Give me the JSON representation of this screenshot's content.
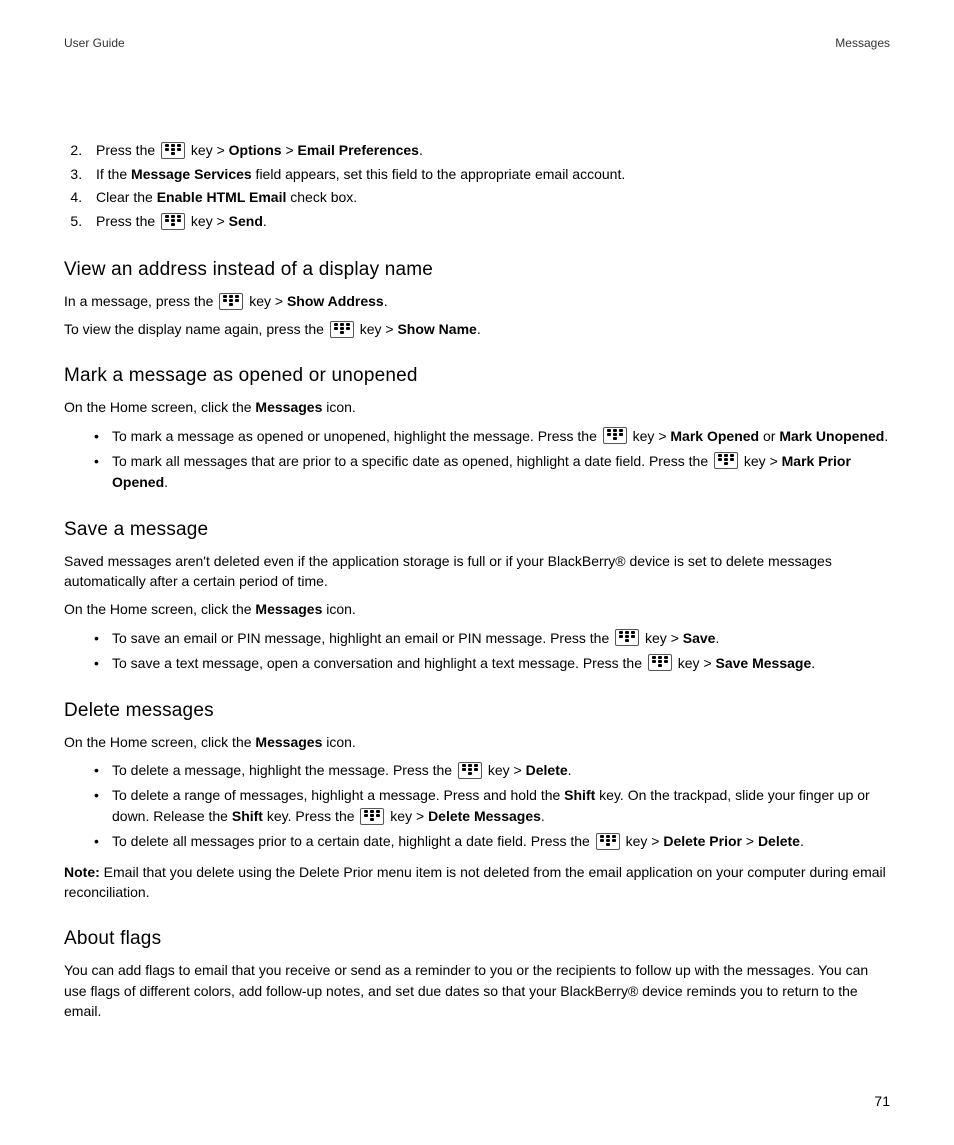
{
  "header": {
    "left": "User Guide",
    "right": "Messages"
  },
  "page_number": "71",
  "steps": {
    "s2": {
      "num": "2.",
      "pre": "Press the ",
      "key_after": " key > ",
      "b1": "Options",
      "mid": " > ",
      "b2": "Email Preferences",
      "end": "."
    },
    "s3": {
      "num": "3.",
      "pre": "If the ",
      "b1": "Message Services",
      "post": " field appears, set this field to the appropriate email account."
    },
    "s4": {
      "num": "4.",
      "pre": "Clear the ",
      "b1": "Enable HTML Email",
      "post": " check box."
    },
    "s5": {
      "num": "5.",
      "pre": "Press the ",
      "key_after": " key > ",
      "b1": "Send",
      "end": "."
    }
  },
  "sec_view": {
    "title": "View an address instead of a display name",
    "p1": {
      "pre": "In a message, press the ",
      "key_after": " key > ",
      "b1": "Show Address",
      "end": "."
    },
    "p2": {
      "pre": "To view the display name again, press the ",
      "key_after": " key > ",
      "b1": "Show Name",
      "end": "."
    }
  },
  "sec_mark": {
    "title": "Mark a message as opened or unopened",
    "intro_pre": "On the Home screen, click the ",
    "intro_b": "Messages",
    "intro_post": " icon.",
    "b1": {
      "pre": "To mark a message as opened or unopened, highlight the message. Press the ",
      "key_after": " key > ",
      "bA": "Mark Opened",
      "mid": " or ",
      "bB": "Mark Unopened",
      "end": "."
    },
    "b2": {
      "pre": "To mark all messages that are prior to a specific date as opened, highlight a date field. Press the ",
      "key_after": " key > ",
      "bA": "Mark Prior Opened",
      "end": "."
    }
  },
  "sec_save": {
    "title": "Save a message",
    "p1": "Saved messages aren't deleted even if the application storage is full or if your BlackBerry® device is set to delete messages automatically after a certain period of time.",
    "intro_pre": "On the Home screen, click the ",
    "intro_b": "Messages",
    "intro_post": " icon.",
    "b1": {
      "pre": "To save an email or PIN message, highlight an email or PIN message. Press the ",
      "key_after": " key > ",
      "bA": "Save",
      "end": "."
    },
    "b2": {
      "pre": "To save a text message, open a conversation and highlight a text message. Press the ",
      "key_after": " key > ",
      "bA": "Save Message",
      "end": "."
    }
  },
  "sec_del": {
    "title": "Delete messages",
    "intro_pre": "On the Home screen, click the ",
    "intro_b": "Messages",
    "intro_post": " icon.",
    "b1": {
      "pre": "To delete a message, highlight the message. Press the ",
      "key_after": " key > ",
      "bA": "Delete",
      "end": "."
    },
    "b2": {
      "pre": "To delete a range of messages, highlight a message. Press and hold the ",
      "bA": "Shift",
      "mid1": " key. On the trackpad, slide your finger up or down. Release the ",
      "bB": "Shift",
      "mid2": " key. Press the ",
      "key_after": " key > ",
      "bC": "Delete Messages",
      "end": "."
    },
    "b3": {
      "pre": "To delete all messages prior to a certain date, highlight a date field. Press the ",
      "key_after": " key > ",
      "bA": "Delete Prior",
      "mid": " > ",
      "bB": "Delete",
      "end": "."
    },
    "note_b": "Note:",
    "note_t": " Email that you delete using the Delete Prior menu item is not deleted from the email application on your computer during email reconciliation."
  },
  "sec_flags": {
    "title": "About flags",
    "p1": "You can add flags to email that you receive or send as a reminder to you or the recipients to follow up with the messages. You can use flags of different colors, add follow-up notes, and set due dates so that your BlackBerry® device reminds you to return to the email."
  }
}
